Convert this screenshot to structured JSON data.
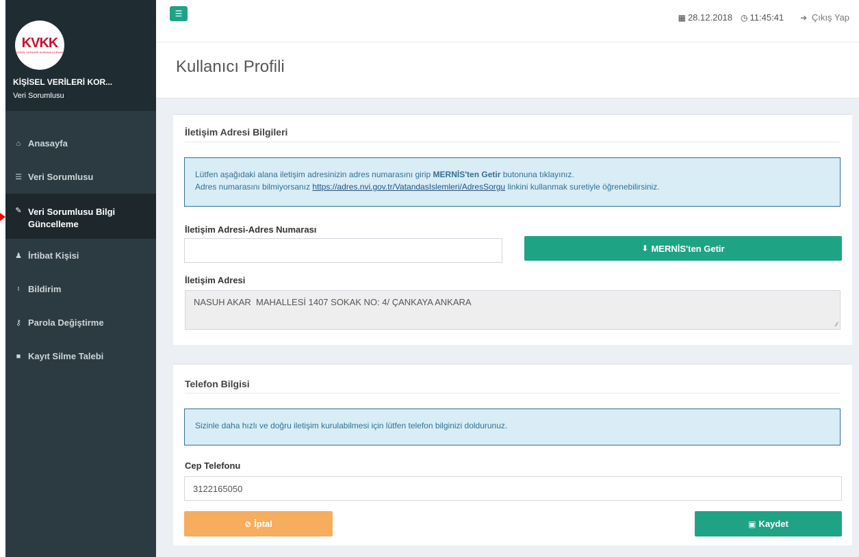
{
  "sidebar": {
    "logo_text": "KVKK",
    "logo_subtext": "KİŞİSEL VERİLERİ KORUMA KURUMU",
    "org_name": "KİŞİSEL VERİLERİ KOR...",
    "org_role": "Veri Sorumlusu",
    "items": [
      {
        "label": "Anasayfa",
        "icon": "home-icon"
      },
      {
        "label": "Veri Sorumlusu",
        "icon": "database-icon"
      },
      {
        "label": "Veri Sorumlusu Bilgi Güncelleme",
        "icon": "edit-icon"
      },
      {
        "label": "İrtibat Kişisi",
        "icon": "user-icon"
      },
      {
        "label": "Bildirim",
        "icon": "bullhorn-icon"
      },
      {
        "label": "Parola Değiştirme",
        "icon": "key-icon"
      },
      {
        "label": "Kayıt Silme Talebi",
        "icon": "trash-icon"
      }
    ]
  },
  "topbar": {
    "date": "28.12.2018",
    "time": "11:45:41",
    "logout": "Çıkış Yap"
  },
  "page": {
    "title": "Kullanıcı Profili"
  },
  "address_box": {
    "title": "İletişim Adresi Bilgileri",
    "info_line1_pre": "Lütfen aşağıdaki alana iletişim adresinizin adres numarasını girip ",
    "info_line1_bold": "MERNİS'ten Getir",
    "info_line1_post": " butonuna tıklayınız.",
    "info_line2_pre": "Adres numarasını bilmiyorsanız ",
    "info_link": "https://adres.nvi.gov.tr/VatandasIslemleri/AdresSorgu",
    "info_line2_post": " linkini kullanmak suretiyle öğrenebilirsiniz.",
    "address_number_label": "İletişim Adresi-Adres Numarası",
    "address_number_value": "",
    "mernis_button": "MERNİS'ten Getir",
    "address_label": "İletişim Adresi",
    "address_value": "NASUH AKAR  MAHALLESİ 1407 SOKAK NO: 4/ ÇANKAYA ANKARA"
  },
  "phone_box": {
    "title": "Telefon Bilgisi",
    "info": "Sizinle daha hızlı ve doğru iletişim kurulabilmesi için lütfen telefon bilginizi doldurunuz.",
    "phone_label": "Cep Telefonu",
    "phone_value": "3122165050",
    "cancel_button": "İptal",
    "save_button": "Kaydet"
  },
  "colors": {
    "accent": "#1fa385",
    "cancel": "#f6ad5d",
    "sidebar_bg": "#2c3b41",
    "callout_bg": "#d9edf7"
  }
}
